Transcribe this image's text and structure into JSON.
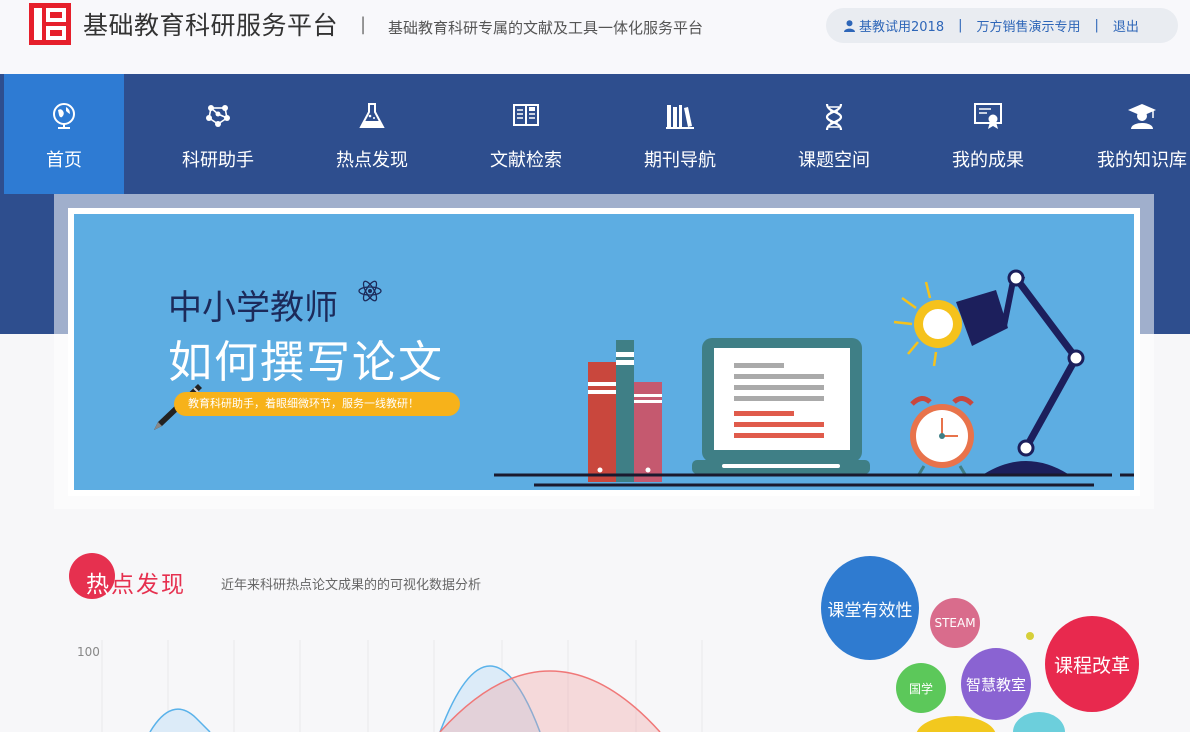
{
  "header": {
    "site_name": "基础教育科研服务平台",
    "separator": "|",
    "slogan": "基础教育科研专属的文献及工具一体化服务平台",
    "user": {
      "name": "基教试用2018",
      "org": "万方销售演示专用",
      "logout": "退出",
      "bar": "|"
    }
  },
  "nav": {
    "items": [
      {
        "label": "首页",
        "icon": "globe-icon"
      },
      {
        "label": "科研助手",
        "icon": "molecule-icon"
      },
      {
        "label": "热点发现",
        "icon": "flask-icon"
      },
      {
        "label": "文献检索",
        "icon": "book-open-icon"
      },
      {
        "label": "期刊导航",
        "icon": "bookshelf-icon"
      },
      {
        "label": "课题空间",
        "icon": "dna-icon"
      },
      {
        "label": "我的成果",
        "icon": "certificate-icon"
      },
      {
        "label": "我的知识库",
        "icon": "graduate-icon"
      }
    ]
  },
  "banner": {
    "title_line1": "中小学教师",
    "title_line2": "如何撰写论文",
    "tagline": "教育科研助手，着眼细微环节，服务一线教研！"
  },
  "hot": {
    "title_first": "热",
    "title_rest": "点发现",
    "subtitle": "近年来科研热点论文成果的的可视化数据分析",
    "y_tick": "100",
    "bubbles": [
      {
        "label": "课堂有效性",
        "color": "#2f7bd0"
      },
      {
        "label": "STEAM",
        "color": "#d96c8c"
      },
      {
        "label": "课程改革",
        "color": "#e8294e"
      },
      {
        "label": "国学",
        "color": "#5cc85a"
      },
      {
        "label": "智慧教室",
        "color": "#8a63d2"
      }
    ]
  }
}
